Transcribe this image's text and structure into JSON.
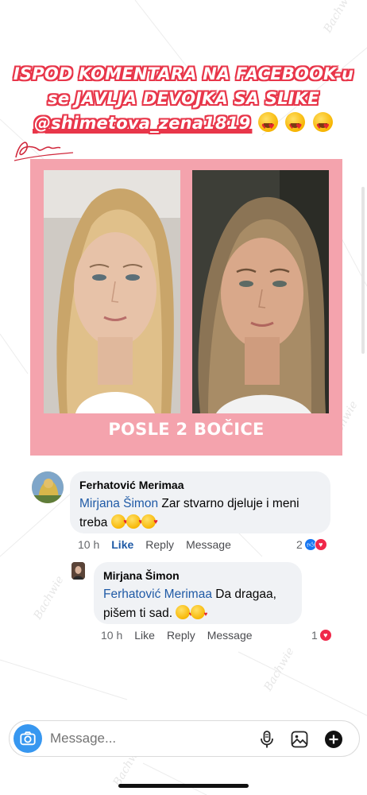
{
  "caption": {
    "line1": "ISPOD KOMENTARA NA FACEBOOK-u",
    "line2": "se JAVLJA DEVOJKA SA SLIKE",
    "handle": "@shimetova_zena1819"
  },
  "card": {
    "label": "POSLE 2 BOČICE",
    "background": "#f4a3ad"
  },
  "comments": [
    {
      "author": "Ferhatović Merimaa",
      "mention": "Mirjana Šimon",
      "text": "Zar stvarno djeluje i meni treba",
      "time": "10 h",
      "like": "Like",
      "reply": "Reply",
      "message": "Message",
      "reaction_count": "2"
    },
    {
      "author": "Mirjana Šimon",
      "mention": "Ferhatović Merimaa",
      "text": "Da dragaa, pišem ti sad.",
      "time": "10 h",
      "like": "Like",
      "reply": "Reply",
      "message": "Message",
      "reaction_count": "1"
    }
  ],
  "message_bar": {
    "placeholder": "Message..."
  },
  "colors": {
    "accent_red": "#e8364a",
    "mention_blue": "#1f5aa6",
    "camera_blue": "#3797f0"
  },
  "icons": [
    "camera-icon",
    "microphone-icon",
    "gallery-icon",
    "add-icon",
    "like-reaction-icon",
    "love-reaction-icon"
  ]
}
